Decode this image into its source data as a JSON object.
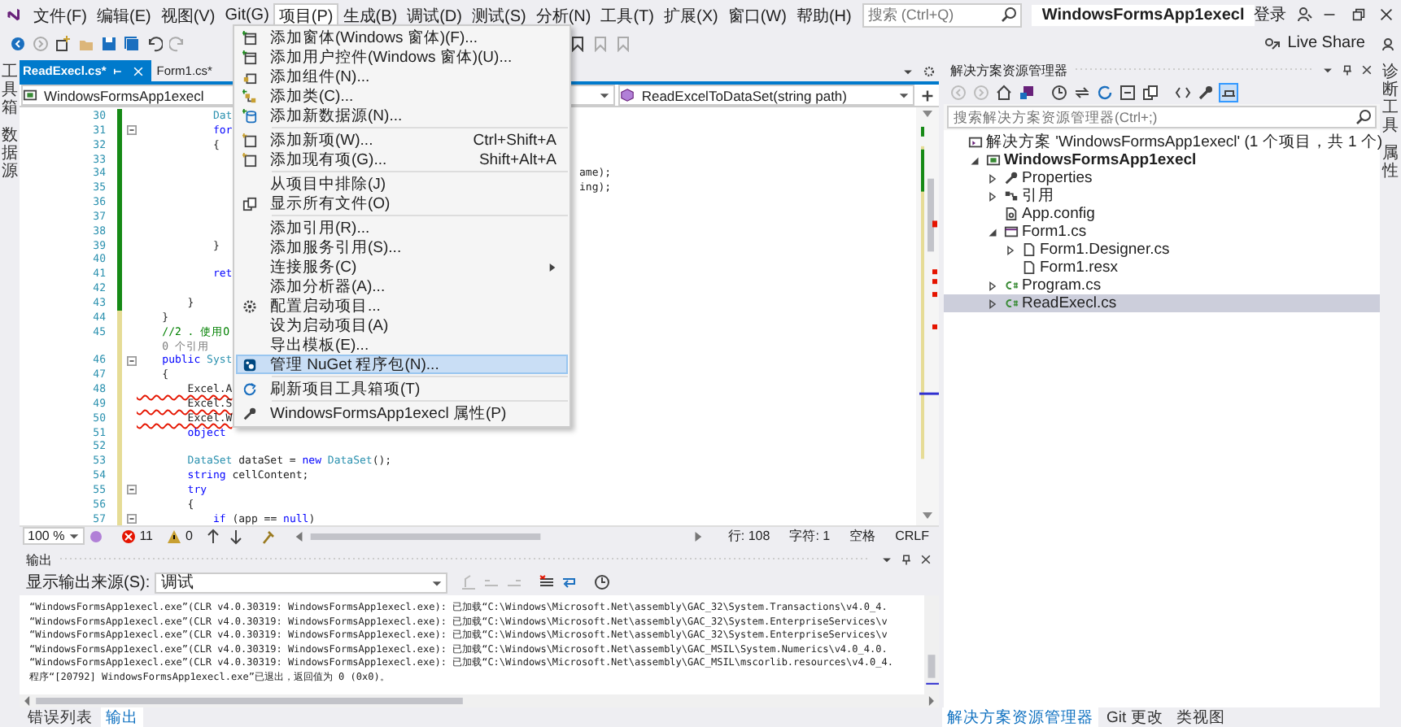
{
  "menu_bar": {
    "items": [
      {
        "label": "文件(F)",
        "selected": false
      },
      {
        "label": "编辑(E)",
        "selected": false
      },
      {
        "label": "视图(V)",
        "selected": false
      },
      {
        "label": "Git(G)",
        "selected": false
      },
      {
        "label": "项目(P)",
        "selected": true
      },
      {
        "label": "生成(B)",
        "selected": false
      },
      {
        "label": "调试(D)",
        "selected": false
      },
      {
        "label": "测试(S)",
        "selected": false
      },
      {
        "label": "分析(N)",
        "selected": false
      },
      {
        "label": "工具(T)",
        "selected": false
      },
      {
        "label": "扩展(X)",
        "selected": false
      },
      {
        "label": "窗口(W)",
        "selected": false
      },
      {
        "label": "帮助(H)",
        "selected": false
      }
    ],
    "search": {
      "placeholder": "搜索 (Ctrl+Q)"
    },
    "title": "WindowsFormsApp1execl",
    "sign_in": "登录"
  },
  "toolbar": {
    "live_share": "Live Share"
  },
  "left_tabs": [
    "工具箱",
    "数据源"
  ],
  "right_tabs": [
    "诊断工具",
    "属性"
  ],
  "editor": {
    "tabs": [
      {
        "label": "ReadExecl.cs*",
        "selected": true
      },
      {
        "label": "Form1.cs*",
        "selected": false
      }
    ],
    "nav": {
      "project": "WindowsFormsApp1execl",
      "member": "ReadExcelToDataSet(string path)"
    },
    "lines": [
      {
        "number": "30",
        "saved": true,
        "fold": false,
        "error": false,
        "segments": [
          {
            "text": "            Dat",
            "kind": "type"
          }
        ]
      },
      {
        "number": "31",
        "saved": true,
        "fold": true,
        "error": false,
        "segments": [
          {
            "text": "            for",
            "kind": "keyword"
          }
        ]
      },
      {
        "number": "32",
        "saved": true,
        "fold": false,
        "error": false,
        "segments": [
          {
            "text": "            {",
            "kind": "plain"
          }
        ]
      },
      {
        "number": "33",
        "saved": true,
        "fold": false
      },
      {
        "number": "34",
        "saved": true,
        "fold": false,
        "after": "ame);"
      },
      {
        "number": "35",
        "saved": true,
        "fold": false,
        "after": "ing);"
      },
      {
        "number": "36",
        "saved": true,
        "fold": false
      },
      {
        "number": "37",
        "saved": true,
        "fold": false
      },
      {
        "number": "38",
        "saved": true,
        "fold": false
      },
      {
        "number": "39",
        "saved": true,
        "fold": false,
        "error": false,
        "segments": [
          {
            "text": "            }",
            "kind": "plain"
          }
        ]
      },
      {
        "number": "40",
        "saved": true,
        "fold": false
      },
      {
        "number": "41",
        "saved": true,
        "fold": false,
        "error": false,
        "segments": [
          {
            "text": "            ret",
            "kind": "keyword"
          }
        ]
      },
      {
        "number": "42",
        "saved": true,
        "fold": false
      },
      {
        "number": "43",
        "saved": true,
        "fold": false,
        "error": false,
        "segments": [
          {
            "text": "        }",
            "kind": "plain"
          }
        ]
      },
      {
        "number": "44",
        "saved": false,
        "fold": false,
        "error": false,
        "segments": [
          {
            "text": "    }",
            "kind": "plain"
          }
        ]
      },
      {
        "number": "45",
        "saved": false,
        "fold": false,
        "error": false,
        "segments": [
          {
            "text": "    //2 . 使用O",
            "kind": "comment"
          }
        ]
      },
      {
        "saved": false,
        "fold": false,
        "error": false,
        "segments": [
          {
            "text": "    0 个引用",
            "kind": "lens"
          }
        ]
      },
      {
        "number": "46",
        "saved": false,
        "fold": true,
        "error": false,
        "segments": [
          {
            "text": "    public",
            "kind": "keyword"
          },
          {
            "text": " Syst",
            "kind": "type"
          }
        ]
      },
      {
        "number": "47",
        "saved": false,
        "fold": false,
        "error": false,
        "segments": [
          {
            "text": "    {",
            "kind": "plain"
          }
        ]
      },
      {
        "number": "48",
        "saved": false,
        "fold": false,
        "error": true,
        "segments": [
          {
            "text": "        Excel.A",
            "kind": "plain"
          }
        ]
      },
      {
        "number": "49",
        "saved": false,
        "fold": false,
        "error": true,
        "segments": [
          {
            "text": "        Excel.S",
            "kind": "plain"
          }
        ]
      },
      {
        "number": "50",
        "saved": false,
        "fold": false,
        "error": true,
        "segments": [
          {
            "text": "        Excel.W",
            "kind": "plain"
          }
        ]
      },
      {
        "number": "51",
        "saved": false,
        "fold": false,
        "error": false,
        "segments": [
          {
            "text": "        object",
            "kind": "keyword"
          }
        ]
      },
      {
        "number": "52",
        "saved": false,
        "fold": false
      },
      {
        "number": "53",
        "saved": false,
        "fold": false,
        "error": false,
        "segments": [
          {
            "text": "        DataSet",
            "kind": "type"
          },
          {
            "text": " dataSet = ",
            "kind": "plain"
          },
          {
            "text": "new",
            "kind": "keyword"
          },
          {
            "text": " DataSet",
            "kind": "type"
          },
          {
            "text": "();",
            "kind": "plain"
          }
        ]
      },
      {
        "number": "54",
        "saved": false,
        "fold": false,
        "error": false,
        "segments": [
          {
            "text": "        string",
            "kind": "keyword"
          },
          {
            "text": " cellContent;",
            "kind": "plain"
          }
        ]
      },
      {
        "number": "55",
        "saved": false,
        "fold": true,
        "error": false,
        "segments": [
          {
            "text": "        try",
            "kind": "keyword"
          }
        ]
      },
      {
        "number": "56",
        "saved": false,
        "fold": false,
        "error": false,
        "segments": [
          {
            "text": "        {",
            "kind": "plain"
          }
        ]
      },
      {
        "number": "57",
        "saved": false,
        "fold": true,
        "error": false,
        "segments": [
          {
            "text": "            if",
            "kind": "keyword"
          },
          {
            "text": " (app == ",
            "kind": "plain"
          },
          {
            "text": "null",
            "kind": "keyword"
          },
          {
            "text": ")",
            "kind": "plain"
          }
        ]
      }
    ],
    "status": {
      "zoom": "100 %",
      "errors": "11",
      "warnings": "0",
      "line": "行: 108",
      "char": "字符: 1",
      "indent": "空格",
      "eol": "CRLF"
    }
  },
  "context_menu": {
    "items": [
      {
        "label": "添加窗体(Windows 窗体)(F)...",
        "submenu": false,
        "selected": false,
        "separator_before": false
      },
      {
        "label": "添加用户控件(Windows 窗体)(U)...",
        "submenu": false,
        "selected": false,
        "separator_before": false
      },
      {
        "label": "添加组件(N)...",
        "submenu": false,
        "selected": false,
        "separator_before": false
      },
      {
        "label": "添加类(C)...",
        "submenu": false,
        "selected": false,
        "separator_before": false
      },
      {
        "label": "添加新数据源(N)...",
        "submenu": false,
        "selected": false,
        "separator_before": false
      },
      {
        "label": "添加新项(W)...",
        "shortcut": "Ctrl+Shift+A",
        "submenu": false,
        "selected": false,
        "separator_before": true
      },
      {
        "label": "添加现有项(G)...",
        "shortcut": "Shift+Alt+A",
        "submenu": false,
        "selected": false,
        "separator_before": false
      },
      {
        "label": "从项目中排除(J)",
        "submenu": false,
        "selected": false,
        "separator_before": true
      },
      {
        "label": "显示所有文件(O)",
        "submenu": false,
        "selected": false,
        "separator_before": false
      },
      {
        "label": "添加引用(R)...",
        "submenu": false,
        "selected": false,
        "separator_before": true
      },
      {
        "label": "添加服务引用(S)...",
        "submenu": false,
        "selected": false,
        "separator_before": false
      },
      {
        "label": "连接服务(C)",
        "submenu": true,
        "selected": false,
        "separator_before": false
      },
      {
        "label": "添加分析器(A)...",
        "submenu": false,
        "selected": false,
        "separator_before": false
      },
      {
        "label": "配置启动项目...",
        "submenu": false,
        "selected": false,
        "separator_before": false
      },
      {
        "label": "设为启动项目(A)",
        "submenu": false,
        "selected": false,
        "separator_before": false
      },
      {
        "label": "导出模板(E)...",
        "submenu": false,
        "selected": false,
        "separator_before": false
      },
      {
        "label": "管理 NuGet 程序包(N)...",
        "submenu": false,
        "selected": true,
        "separator_before": false
      },
      {
        "label": "刷新项目工具箱项(T)",
        "submenu": false,
        "selected": false,
        "separator_before": true
      },
      {
        "label": "WindowsFormsApp1execl 属性(P)",
        "submenu": false,
        "selected": false,
        "separator_before": true
      }
    ]
  },
  "output": {
    "title": "输出",
    "source_label": "显示输出来源(S):",
    "source": "调试",
    "lines": [
      "“WindowsFormsApp1execl.exe”(CLR v4.0.30319: WindowsFormsApp1execl.exe): 已加载“C:\\Windows\\Microsoft.Net\\assembly\\GAC_32\\System.Transactions\\v4.0_4.",
      "“WindowsFormsApp1execl.exe”(CLR v4.0.30319: WindowsFormsApp1execl.exe): 已加载“C:\\Windows\\Microsoft.Net\\assembly\\GAC_32\\System.EnterpriseServices\\v",
      "“WindowsFormsApp1execl.exe”(CLR v4.0.30319: WindowsFormsApp1execl.exe): 已加载“C:\\Windows\\Microsoft.Net\\assembly\\GAC_32\\System.EnterpriseServices\\v",
      "“WindowsFormsApp1execl.exe”(CLR v4.0.30319: WindowsFormsApp1execl.exe): 已加载“C:\\Windows\\Microsoft.Net\\assembly\\GAC_MSIL\\System.Numerics\\v4.0_4.0.",
      "“WindowsFormsApp1execl.exe”(CLR v4.0.30319: WindowsFormsApp1execl.exe): 已加载“C:\\Windows\\Microsoft.Net\\assembly\\GAC_MSIL\\mscorlib.resources\\v4.0_4.",
      "程序“[20792] WindowsFormsApp1execl.exe”已退出，返回值为 0 (0x0)。"
    ]
  },
  "solution_explorer": {
    "title": "解决方案资源管理器",
    "search": {
      "placeholder": "搜索解决方案资源管理器(Ctrl+;)"
    },
    "tree": [
      {
        "label": "解决方案 'WindowsFormsApp1execl' (1 个项目，共 1 个)",
        "kind": "solution",
        "expandable": false,
        "selected": false,
        "children": [
          {
            "label": "WindowsFormsApp1execl",
            "kind": "project",
            "expandable": true,
            "expanded": true,
            "selected": false,
            "children": [
              {
                "label": "Properties",
                "kind": "properties",
                "expandable": true,
                "expanded": false,
                "selected": false
              },
              {
                "label": "引用",
                "kind": "references",
                "expandable": true,
                "expanded": false,
                "selected": false
              },
              {
                "label": "App.config",
                "kind": "config",
                "expandable": false,
                "selected": false
              },
              {
                "label": "Form1.cs",
                "kind": "form",
                "expandable": true,
                "expanded": true,
                "selected": false,
                "children": [
                  {
                    "label": "Form1.Designer.cs",
                    "kind": "file",
                    "expandable": true,
                    "expanded": false,
                    "selected": false
                  },
                  {
                    "label": "Form1.resx",
                    "kind": "file",
                    "expandable": false,
                    "selected": false
                  }
                ]
              },
              {
                "label": "Program.cs",
                "kind": "csharp",
                "expandable": true,
                "expanded": false,
                "selected": false
              },
              {
                "label": "ReadExecl.cs",
                "kind": "csharp",
                "expandable": true,
                "expanded": false,
                "selected": true
              }
            ]
          }
        ]
      }
    ]
  },
  "bottom_tabs_left": [
    {
      "label": "错误列表",
      "selected": false
    },
    {
      "label": "输出",
      "selected": true
    }
  ],
  "bottom_tabs_right": [
    {
      "label": "解决方案资源管理器",
      "selected": true
    },
    {
      "label": "Git 更改",
      "selected": false
    },
    {
      "label": "类视图",
      "selected": false
    }
  ]
}
